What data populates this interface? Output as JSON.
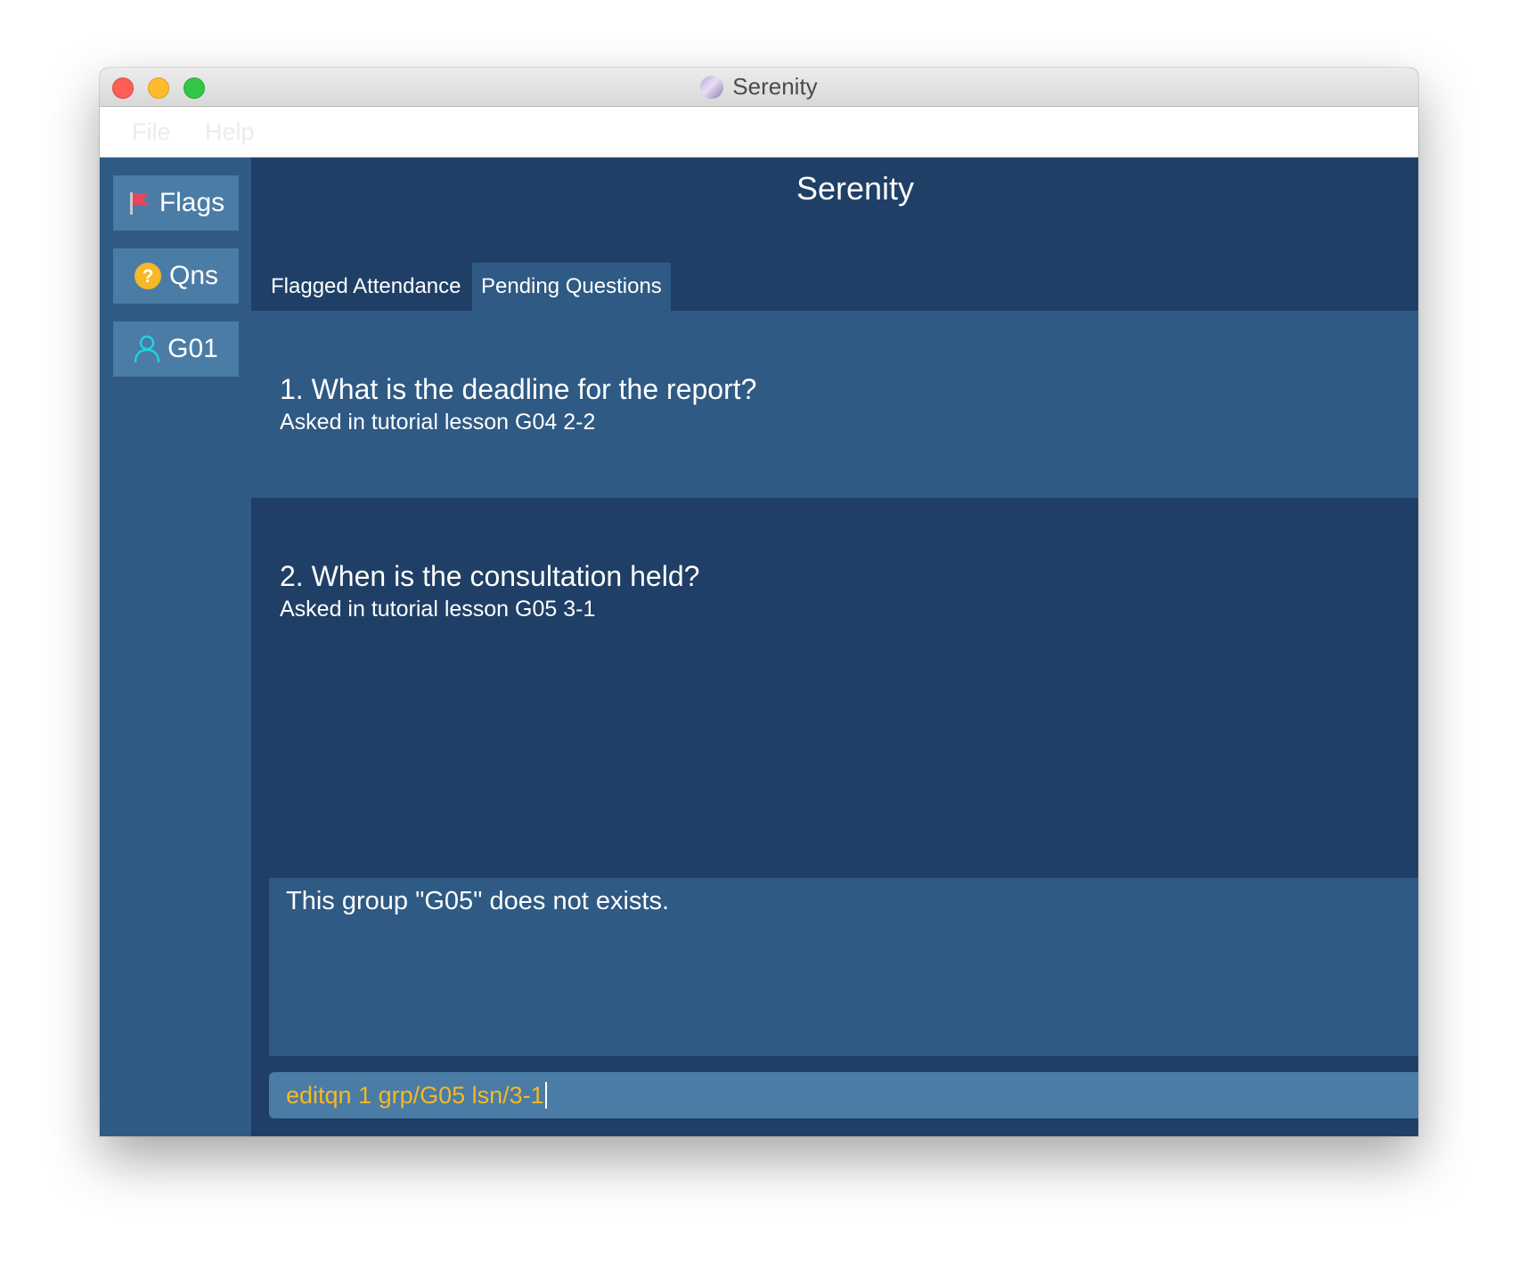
{
  "window": {
    "title": "Serenity",
    "app_icon": "serenity-logo-icon"
  },
  "menubar": {
    "items": [
      {
        "label": "File"
      },
      {
        "label": "Help"
      }
    ]
  },
  "sidebar": {
    "items": [
      {
        "label": "Flags",
        "icon": "flag-icon"
      },
      {
        "label": "Qns",
        "icon": "question-icon"
      },
      {
        "label": "G01",
        "icon": "person-icon"
      }
    ]
  },
  "main": {
    "title": "Serenity",
    "tabs": [
      {
        "label": "Flagged Attendance",
        "active": false
      },
      {
        "label": "Pending Questions",
        "active": true
      }
    ],
    "questions": [
      {
        "index": "1.",
        "text": "What is the deadline for the report?",
        "subtitle": "Asked in tutorial lesson G04 2-2"
      },
      {
        "index": "2.",
        "text": "When is the consultation held?",
        "subtitle": "Asked in tutorial lesson G05 3-1"
      }
    ]
  },
  "result": {
    "message": "This group \"G05\" does not exists."
  },
  "command": {
    "value": "editqn 1 grp/G05 lsn/3-1"
  },
  "colors": {
    "window_bg": "#1f3f66",
    "sidebar_bg": "#2e5a84",
    "button_bg": "#4a7ca5",
    "command_text": "#f6b824",
    "flag": "#e8455b",
    "question_badge": "#f6b824",
    "person": "#21d3df"
  }
}
